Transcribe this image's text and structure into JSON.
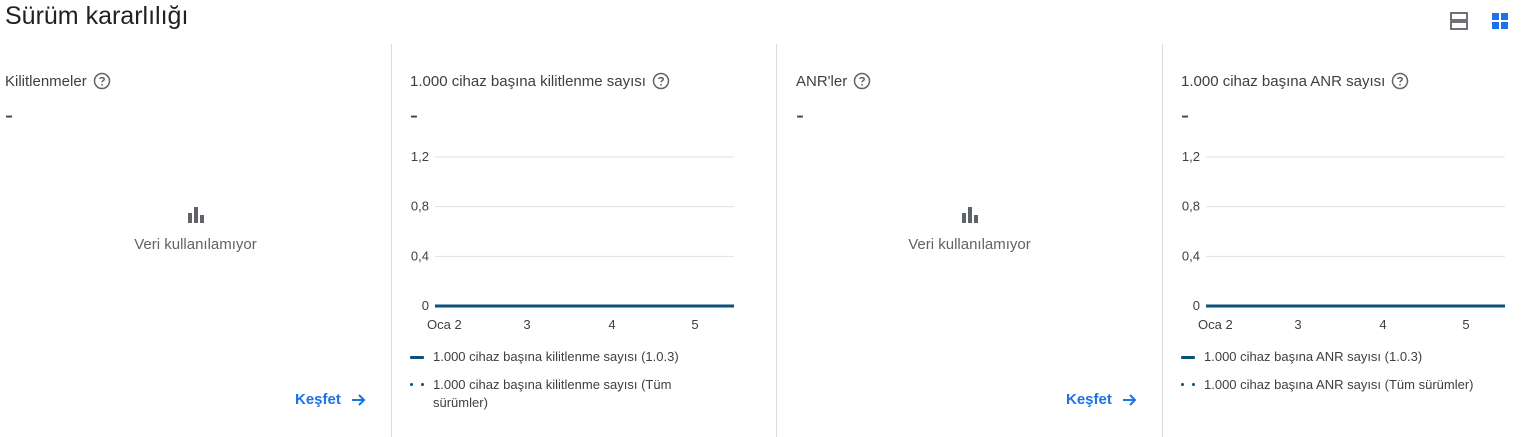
{
  "page": {
    "title": "Sürüm kararlılığı"
  },
  "cards": [
    {
      "title": "Kilitlenmeler",
      "value": "-",
      "empty_text": "Veri kullanılamıyor",
      "explore_label": "Keşfet"
    },
    {
      "title": "1.000 cihaz başına kilitlenme sayısı",
      "value": "-",
      "legend": [
        "1.000 cihaz başına kilitlenme sayısı (1.0.3)",
        "1.000 cihaz başına kilitlenme sayısı (Tüm sürümler)"
      ]
    },
    {
      "title": "ANR'ler",
      "value": "-",
      "empty_text": "Veri kullanılamıyor",
      "explore_label": "Keşfet"
    },
    {
      "title": "1.000 cihaz başına ANR sayısı",
      "value": "-",
      "legend": [
        "1.000 cihaz başına ANR sayısı (1.0.3)",
        "1.000 cihaz başına ANR sayısı (Tüm sürümler)"
      ]
    }
  ],
  "chart_data": [
    {
      "type": "line",
      "x": [
        "Oca 2",
        "3",
        "4",
        "5"
      ],
      "y_ticks": [
        "1,2",
        "0,8",
        "0,4",
        "0"
      ],
      "ylim": [
        0,
        1.2
      ],
      "series": [
        {
          "name": "1.000 cihaz başına kilitlenme sayısı (1.0.3)",
          "values": [
            0,
            0,
            0,
            0
          ],
          "style": "solid",
          "color": "#0b4f7b"
        },
        {
          "name": "1.000 cihaz başına kilitlenme sayısı (Tüm sürümler)",
          "values": [
            0,
            0,
            0,
            0
          ],
          "style": "dotted",
          "color": "#0b4f7b"
        }
      ]
    },
    {
      "type": "line",
      "x": [
        "Oca 2",
        "3",
        "4",
        "5"
      ],
      "y_ticks": [
        "1,2",
        "0,8",
        "0,4",
        "0"
      ],
      "ylim": [
        0,
        1.2
      ],
      "series": [
        {
          "name": "1.000 cihaz başına ANR sayısı (1.0.3)",
          "values": [
            0,
            0,
            0,
            0
          ],
          "style": "solid",
          "color": "#0b4f7b"
        },
        {
          "name": "1.000 cihaz başına ANR sayısı (Tüm sürümler)",
          "values": [
            0,
            0,
            0,
            0
          ],
          "style": "dotted",
          "color": "#0b4f7b"
        }
      ]
    }
  ],
  "colors": {
    "accent": "#1a73e8",
    "series": "#0b4f7b",
    "grid": "#e0e0e0",
    "divider": "#dadce0"
  }
}
